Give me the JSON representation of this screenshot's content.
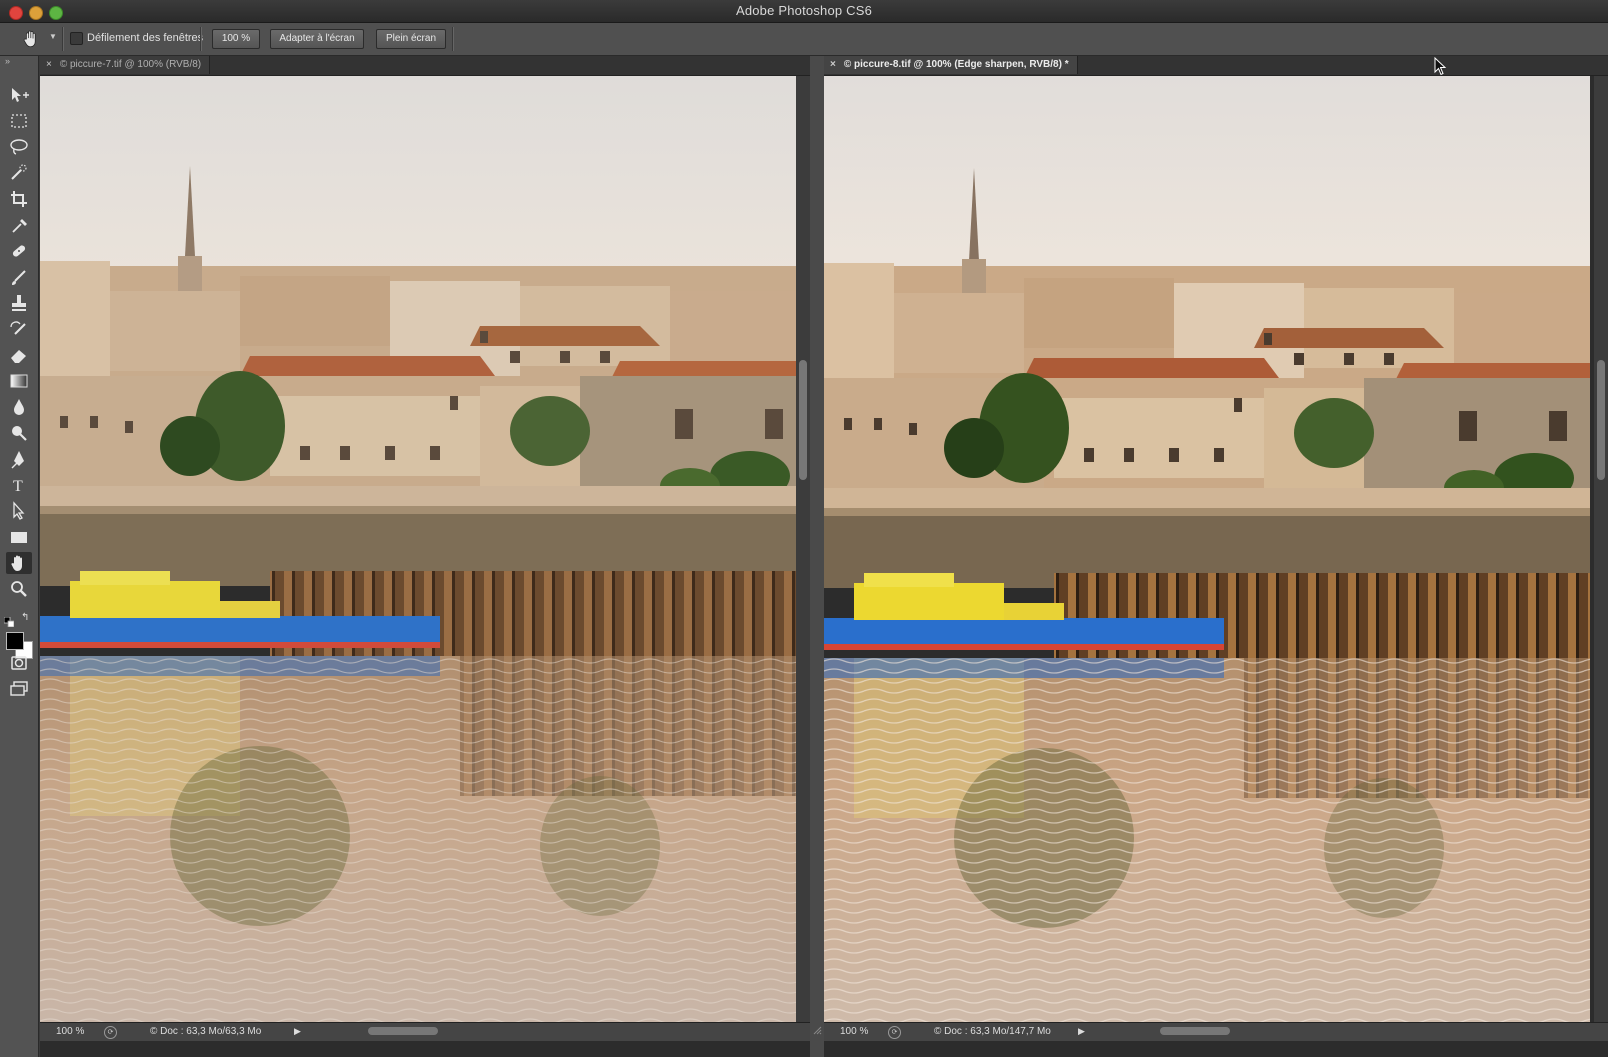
{
  "window": {
    "title": "Adobe Photoshop CS6"
  },
  "options_bar": {
    "scroll_all_windows_label": "Défilement des fenêtres",
    "scroll_all_windows_checked": false,
    "zoom_label": "100 %",
    "fit_screen_label": "Adapter à l'écran",
    "full_screen_label": "Plein écran"
  },
  "toolbar": {
    "tools": [
      "move-tool",
      "marquee-tool",
      "lasso-tool",
      "quick-select-tool",
      "crop-tool",
      "eyedropper-tool",
      "healing-brush-tool",
      "brush-tool",
      "clone-stamp-tool",
      "history-brush-tool",
      "eraser-tool",
      "gradient-tool",
      "blur-tool",
      "dodge-tool",
      "pen-tool",
      "type-tool",
      "path-select-tool",
      "rectangle-tool",
      "hand-tool",
      "zoom-tool",
      "quick-mask",
      "screen-mode"
    ],
    "active_tool": "hand-tool",
    "foreground_color": "#000000",
    "background_color": "#ffffff"
  },
  "documents": [
    {
      "tab_label": "© piccure-7.tif @ 100% (RVB/8)",
      "status": {
        "zoom": "100 %",
        "info": "© Doc : 63,3 Mo/63,3 Mo"
      }
    },
    {
      "tab_label": "© piccure-8.tif @ 100% (Edge sharpen, RVB/8) *",
      "status": {
        "zoom": "100 %",
        "info": "© Doc : 63,3 Mo/147,7 Mo"
      }
    }
  ]
}
